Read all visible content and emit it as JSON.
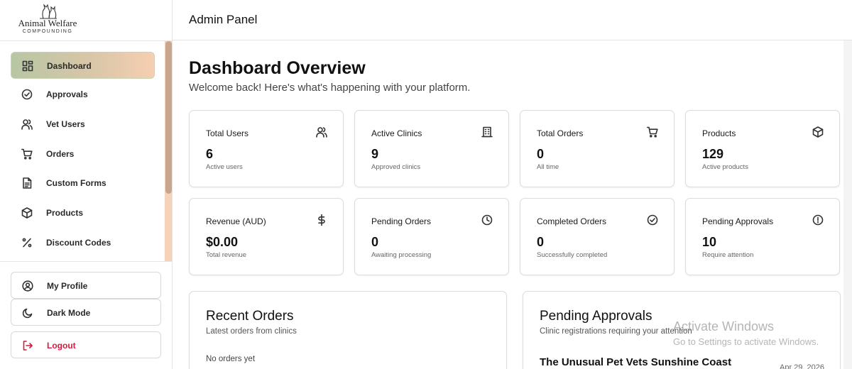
{
  "brand": {
    "name": "Animal Welfare",
    "subtitle": "COMPOUNDING"
  },
  "header": {
    "title": "Admin Panel"
  },
  "sidebar": {
    "items": [
      {
        "label": "Dashboard",
        "icon": "dashboard-icon",
        "active": true
      },
      {
        "label": "Approvals",
        "icon": "check-circle-icon"
      },
      {
        "label": "Vet Users",
        "icon": "users-icon"
      },
      {
        "label": "Orders",
        "icon": "cart-icon"
      },
      {
        "label": "Custom Forms",
        "icon": "document-icon"
      },
      {
        "label": "Products",
        "icon": "box-icon"
      },
      {
        "label": "Discount Codes",
        "icon": "percent-icon"
      }
    ],
    "bottom": {
      "profile": "My Profile",
      "dark_mode": "Dark Mode",
      "logout": "Logout"
    }
  },
  "main": {
    "title": "Dashboard Overview",
    "subtitle": "Welcome back! Here's what's happening with your platform.",
    "stats": [
      {
        "title": "Total Users",
        "value": "6",
        "note": "Active users",
        "icon": "users-icon"
      },
      {
        "title": "Active Clinics",
        "value": "9",
        "note": "Approved clinics",
        "icon": "building-icon"
      },
      {
        "title": "Total Orders",
        "value": "0",
        "note": "All time",
        "icon": "cart-icon"
      },
      {
        "title": "Products",
        "value": "129",
        "note": "Active products",
        "icon": "box-icon"
      },
      {
        "title": "Revenue (AUD)",
        "value": "$0.00",
        "note": "Total revenue",
        "icon": "dollar-icon"
      },
      {
        "title": "Pending Orders",
        "value": "0",
        "note": "Awaiting processing",
        "icon": "clock-icon"
      },
      {
        "title": "Completed Orders",
        "value": "0",
        "note": "Successfully completed",
        "icon": "check-circle-icon"
      },
      {
        "title": "Pending Approvals",
        "value": "10",
        "note": "Require attention",
        "icon": "alert-circle-icon"
      }
    ],
    "recent_orders": {
      "title": "Recent Orders",
      "subtitle": "Latest orders from clinics",
      "empty": "No orders yet"
    },
    "pending_approvals": {
      "title": "Pending Approvals",
      "subtitle": "Clinic registrations requiring your attention",
      "items": [
        {
          "name": "The Unusual Pet Vets Sunshine Coast",
          "date": "Apr 29, 2026"
        }
      ]
    }
  },
  "watermark": {
    "line1": "Activate Windows",
    "line2": "Go to Settings to activate Windows."
  },
  "colors": {
    "logout": "#d21a3e",
    "active_start": "#b7c6a3",
    "active_end": "#f6cfb2",
    "scroll": "#c9a58e"
  }
}
